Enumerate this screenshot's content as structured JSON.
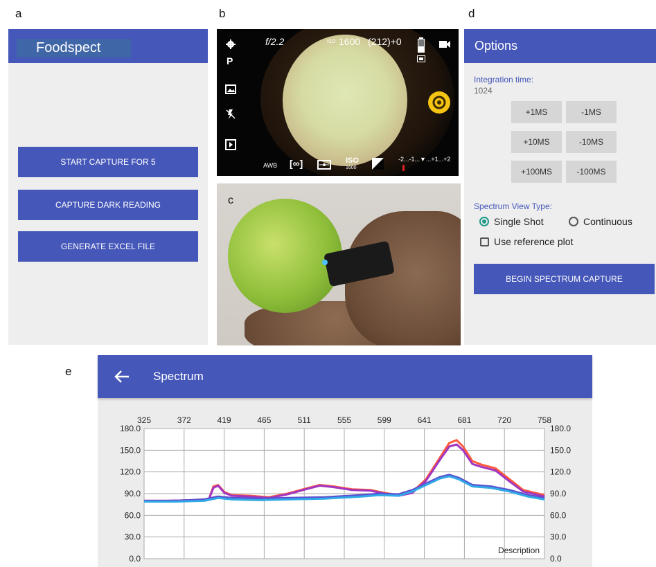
{
  "panel_letters": {
    "a": "a",
    "b": "b",
    "c": "c",
    "d": "d",
    "e": "e"
  },
  "panel_a": {
    "app_title": "Foodspect",
    "buttons": [
      "START CAPTURE FOR 5",
      "CAPTURE DARK READING",
      "GENERATE EXCEL FILE"
    ]
  },
  "panel_b": {
    "aperture": "f/2.2",
    "iso_label": "ISO",
    "iso_value": "1600",
    "shots": "(212)+0",
    "mode": "P",
    "awb": "AWB",
    "focus": "[∞]",
    "iso_bottom": "ISO",
    "iso_bottom_value": "1600",
    "exposure_scale": "-2...-1...▼...+1...+2"
  },
  "panel_d": {
    "title": "Options",
    "integration_label": "Integration time:",
    "integration_value": "1024",
    "buttons": [
      [
        "+1MS",
        "-1MS"
      ],
      [
        "+10MS",
        "-10MS"
      ],
      [
        "+100MS",
        "-100MS"
      ]
    ],
    "view_type_label": "Spectrum View Type:",
    "radio_single": "Single Shot",
    "radio_continuous": "Continuous",
    "selected": "Single Shot",
    "checkbox_label": "Use reference plot",
    "checkbox_checked": false,
    "begin_button": "BEGIN SPECTRUM CAPTURE"
  },
  "panel_e": {
    "title": "Spectrum",
    "back_icon": "arrow-left-icon"
  },
  "chart_data": {
    "type": "line",
    "x_top_ticks": [
      "325",
      "372",
      "419",
      "465",
      "511",
      "555",
      "599",
      "641",
      "681",
      "720",
      "758"
    ],
    "y_ticks": [
      "180.0",
      "150.0",
      "120.0",
      "90.0",
      "60.0",
      "30.0",
      "0.0"
    ],
    "ylim": [
      0,
      180
    ],
    "xlim": [
      325,
      758
    ],
    "legend_text": "Description",
    "grid": true,
    "series": [
      {
        "color": "#ff5a3c",
        "points": [
          [
            325,
            80
          ],
          [
            350,
            80
          ],
          [
            380,
            81
          ],
          [
            395,
            82
          ],
          [
            400,
            100
          ],
          [
            405,
            102
          ],
          [
            412,
            92
          ],
          [
            420,
            88
          ],
          [
            440,
            87
          ],
          [
            460,
            85
          ],
          [
            480,
            90
          ],
          [
            500,
            97
          ],
          [
            515,
            102
          ],
          [
            530,
            100
          ],
          [
            550,
            96
          ],
          [
            570,
            95
          ],
          [
            585,
            91
          ],
          [
            600,
            88
          ],
          [
            615,
            92
          ],
          [
            630,
            110
          ],
          [
            645,
            140
          ],
          [
            655,
            160
          ],
          [
            663,
            164
          ],
          [
            670,
            155
          ],
          [
            680,
            135
          ],
          [
            690,
            130
          ],
          [
            705,
            125
          ],
          [
            720,
            110
          ],
          [
            735,
            95
          ],
          [
            758,
            88
          ]
        ]
      },
      {
        "color": "#a235c0",
        "points": [
          [
            325,
            80
          ],
          [
            350,
            80
          ],
          [
            380,
            81
          ],
          [
            395,
            82
          ],
          [
            400,
            98
          ],
          [
            405,
            101
          ],
          [
            412,
            91
          ],
          [
            420,
            87
          ],
          [
            440,
            86
          ],
          [
            460,
            84
          ],
          [
            480,
            89
          ],
          [
            500,
            96
          ],
          [
            515,
            101
          ],
          [
            530,
            99
          ],
          [
            550,
            95
          ],
          [
            570,
            94
          ],
          [
            585,
            90
          ],
          [
            600,
            87
          ],
          [
            615,
            91
          ],
          [
            630,
            108
          ],
          [
            645,
            137
          ],
          [
            655,
            155
          ],
          [
            663,
            158
          ],
          [
            670,
            150
          ],
          [
            680,
            131
          ],
          [
            690,
            127
          ],
          [
            705,
            122
          ],
          [
            720,
            107
          ],
          [
            735,
            93
          ],
          [
            758,
            86
          ]
        ]
      },
      {
        "color": "#5c4fcf",
        "points": [
          [
            325,
            80
          ],
          [
            360,
            80
          ],
          [
            390,
            82
          ],
          [
            405,
            86
          ],
          [
            420,
            84
          ],
          [
            450,
            83
          ],
          [
            480,
            84
          ],
          [
            520,
            85
          ],
          [
            560,
            88
          ],
          [
            580,
            90
          ],
          [
            600,
            89
          ],
          [
            615,
            95
          ],
          [
            630,
            104
          ],
          [
            645,
            113
          ],
          [
            655,
            116
          ],
          [
            665,
            112
          ],
          [
            680,
            102
          ],
          [
            700,
            100
          ],
          [
            720,
            95
          ],
          [
            740,
            88
          ],
          [
            758,
            84
          ]
        ]
      },
      {
        "color": "#30a9e6",
        "points": [
          [
            325,
            79
          ],
          [
            360,
            79
          ],
          [
            390,
            80
          ],
          [
            405,
            84
          ],
          [
            420,
            82
          ],
          [
            450,
            81
          ],
          [
            480,
            82
          ],
          [
            520,
            83
          ],
          [
            560,
            86
          ],
          [
            580,
            88
          ],
          [
            600,
            87
          ],
          [
            615,
            93
          ],
          [
            630,
            102
          ],
          [
            645,
            111
          ],
          [
            655,
            114
          ],
          [
            665,
            110
          ],
          [
            680,
            100
          ],
          [
            700,
            98
          ],
          [
            720,
            93
          ],
          [
            740,
            86
          ],
          [
            758,
            82
          ]
        ]
      }
    ]
  }
}
